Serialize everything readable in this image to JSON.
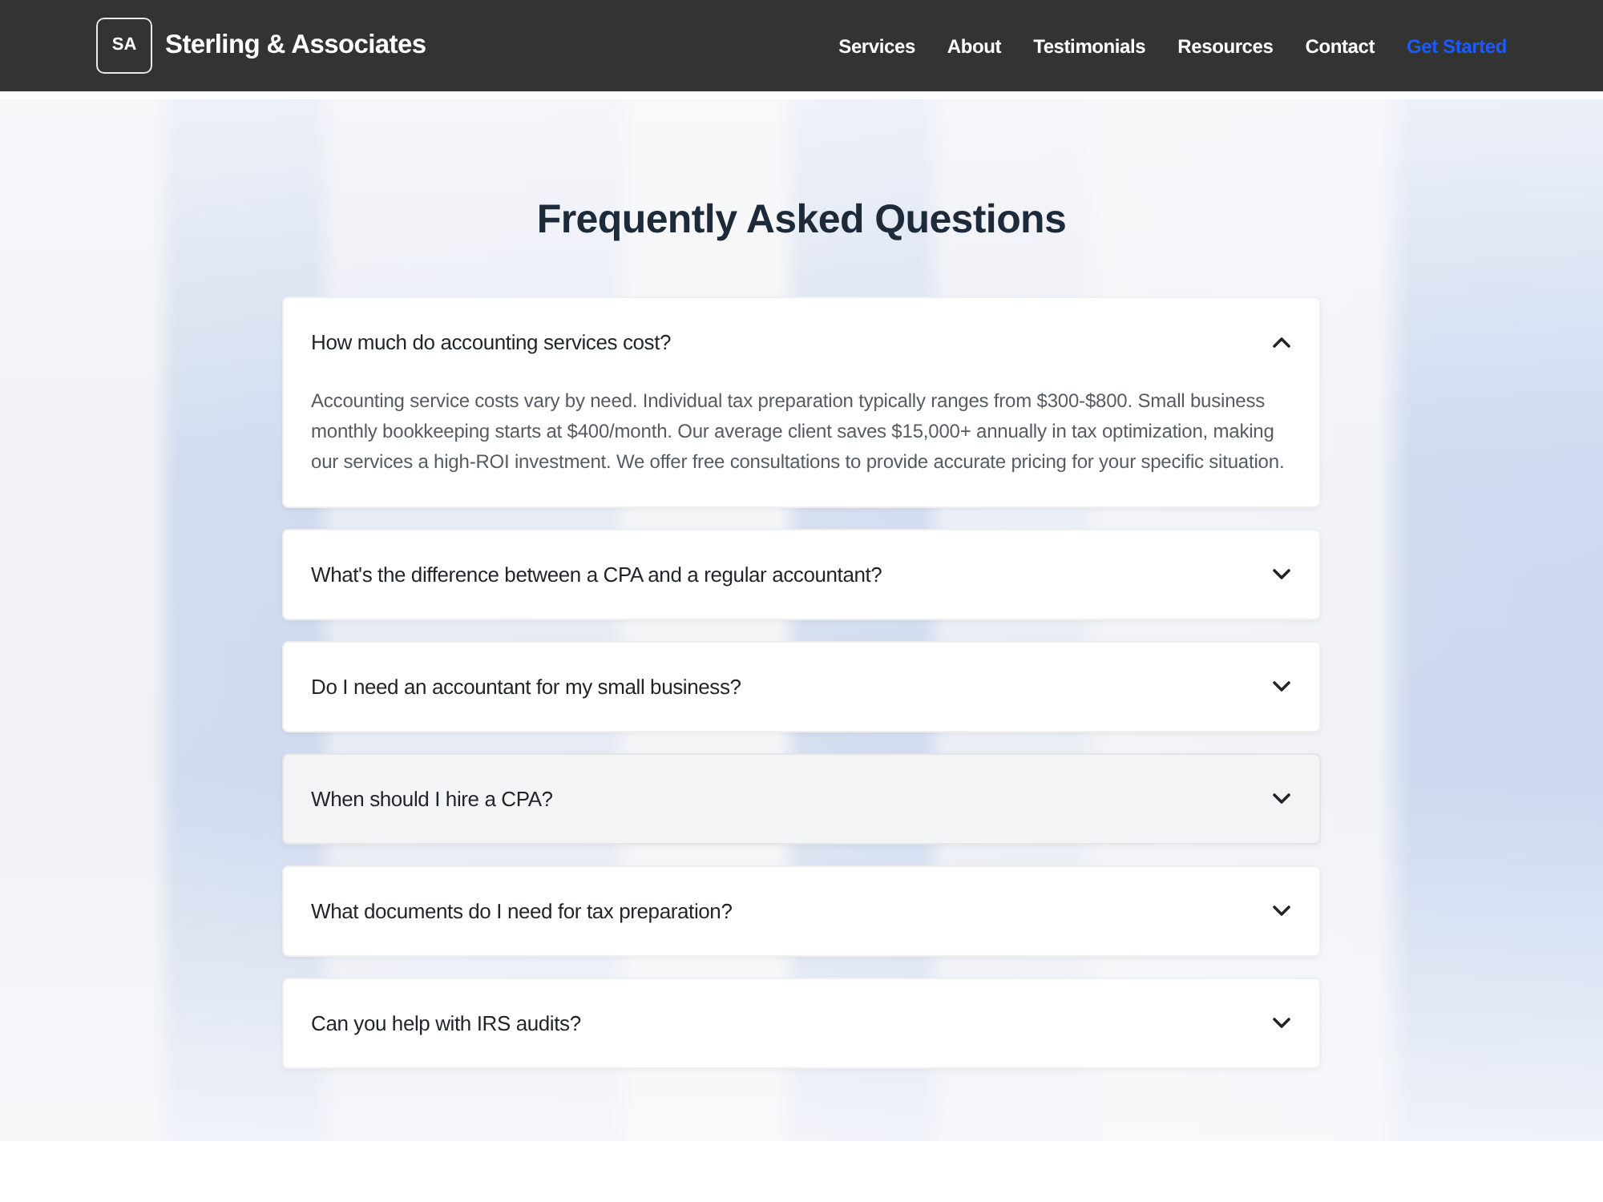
{
  "navbar": {
    "logo_mark": "SA",
    "brand": "Sterling & Associates",
    "links": [
      {
        "label": "Services",
        "kind": "link"
      },
      {
        "label": "About",
        "kind": "link"
      },
      {
        "label": "Testimonials",
        "kind": "link"
      },
      {
        "label": "Resources",
        "kind": "link"
      },
      {
        "label": "Contact",
        "kind": "link"
      },
      {
        "label": "Get Started",
        "kind": "cta"
      }
    ]
  },
  "faq": {
    "title": "Frequently Asked Questions",
    "items": [
      {
        "question": "How much do accounting services cost?",
        "answer": "Accounting service costs vary by need. Individual tax preparation typically ranges from $300-$800. Small business monthly bookkeeping starts at $400/month. Our average client saves $15,000+ annually in tax optimization, making our services a high-ROI investment. We offer free consultations to provide accurate pricing for your specific situation.",
        "expanded": true,
        "highlighted": false
      },
      {
        "question": "What's the difference between a CPA and a regular accountant?",
        "expanded": false,
        "highlighted": false
      },
      {
        "question": "Do I need an accountant for my small business?",
        "expanded": false,
        "highlighted": false
      },
      {
        "question": "When should I hire a CPA?",
        "expanded": false,
        "highlighted": true
      },
      {
        "question": "What documents do I need for tax preparation?",
        "expanded": false,
        "highlighted": false
      },
      {
        "question": "Can you help with IRS audits?",
        "expanded": false,
        "highlighted": false
      }
    ]
  }
}
